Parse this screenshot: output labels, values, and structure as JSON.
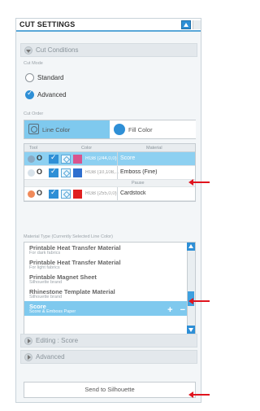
{
  "panel": {
    "title": "CUT SETTINGS"
  },
  "cut_conditions": {
    "header": "Cut Conditions",
    "cut_mode_label": "Cut Mode",
    "modes": [
      {
        "label": "Standard",
        "checked": false
      },
      {
        "label": "Advanced",
        "checked": true
      }
    ],
    "cut_order_label": "Cut Order",
    "tabs": [
      {
        "label": "Line Color",
        "active": true
      },
      {
        "label": "Fill Color",
        "active": false
      }
    ]
  },
  "table": {
    "headers": [
      "Tool",
      "Color",
      "Material"
    ],
    "rows": [
      {
        "rgb": "RGB (244,0,0)",
        "material": "Score",
        "swatch": "#d9538d",
        "tool_color": "#8aa9c2",
        "selected": true
      },
      {
        "rgb": "RGB (10,108,...",
        "material": "Emboss (Fine)",
        "swatch": "#2e6fcf",
        "tool_color": "#2e8fd6",
        "selected": false
      },
      {
        "rgb": "RGB (255,0,0)",
        "material": "Cardstock",
        "swatch": "#e02020",
        "tool_color": "#f08a5a",
        "selected": false
      }
    ],
    "pause_label": "Pause"
  },
  "material_list": {
    "label": "Material Type (Currently Selected Line Color)",
    "items": [
      {
        "name": "Printable Heat Transfer Material",
        "sub": "For dark fabrics",
        "selected": false
      },
      {
        "name": "Printable Heat Transfer Material",
        "sub": "For light fabrics",
        "selected": false
      },
      {
        "name": "Printable Magnet Sheet",
        "sub": "Silhouette brand",
        "selected": false
      },
      {
        "name": "Rhinestone Template Material",
        "sub": "Silhouette brand",
        "selected": false
      },
      {
        "name": "Score",
        "sub": "Score & Emboss Paper",
        "selected": true
      }
    ],
    "add_symbol": "+",
    "remove_symbol": "−"
  },
  "sections": {
    "editing_score": "Editing : Score",
    "advanced": "Advanced"
  },
  "actions": {
    "send": "Send to Silhouette"
  },
  "colors": {
    "accent": "#2e8fd6",
    "selected_row": "#8dd0f1",
    "annotation_arrow": "#e0141e"
  }
}
